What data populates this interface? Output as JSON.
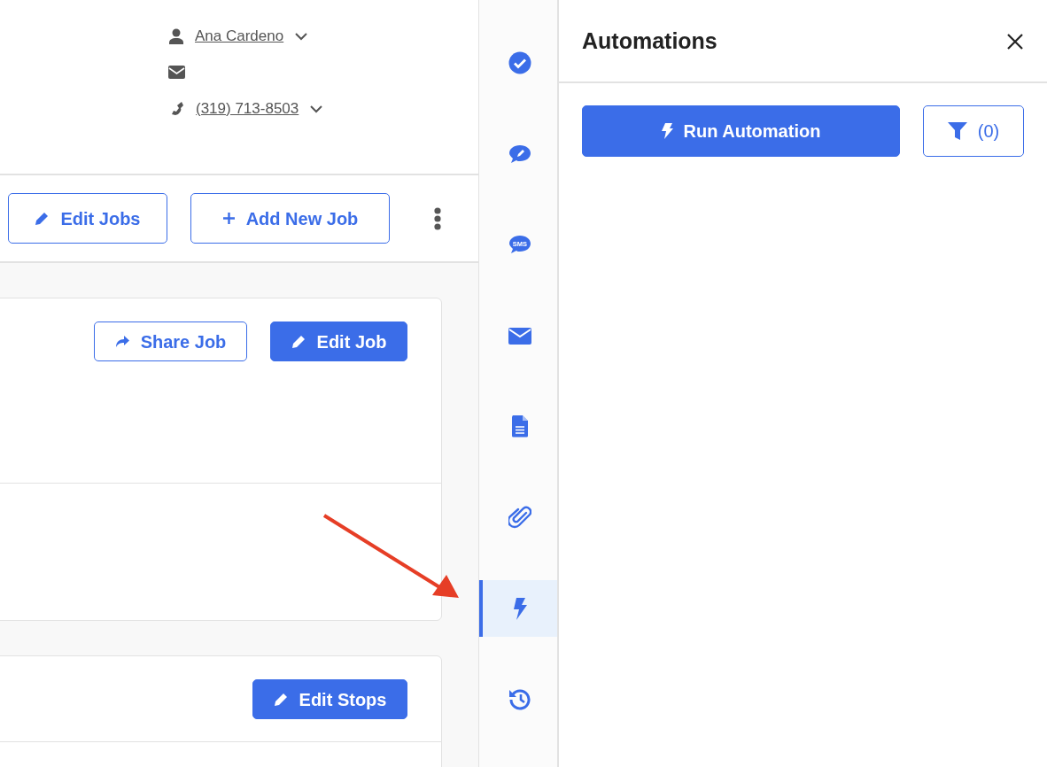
{
  "contact": {
    "name": "Ana Cardeno",
    "phone": "(319) 713-8503"
  },
  "toolbar": {
    "buttons": [
      {
        "label": "Edit Jobs"
      },
      {
        "label": "Add New Job"
      }
    ]
  },
  "job_card": {
    "buttons": [
      {
        "label": "Share Job",
        "kind": "outline"
      },
      {
        "label": "Edit Job",
        "kind": "solid"
      }
    ]
  },
  "stops_card": {
    "buttons": [
      {
        "label": "Edit Stops",
        "kind": "solid"
      }
    ]
  },
  "rail": {
    "items": [
      {
        "kind": "check",
        "selected": false
      },
      {
        "kind": "chat-pencil",
        "selected": false
      },
      {
        "kind": "sms",
        "text": "SMS",
        "selected": false
      },
      {
        "kind": "envelope",
        "selected": false
      },
      {
        "kind": "document",
        "selected": false
      },
      {
        "kind": "paperclip",
        "selected": false
      },
      {
        "kind": "bolt",
        "selected": true
      },
      {
        "kind": "history",
        "selected": false
      }
    ]
  },
  "panel": {
    "title": "Automations",
    "run_button": "Run Automation",
    "filter_count": "(0)"
  }
}
